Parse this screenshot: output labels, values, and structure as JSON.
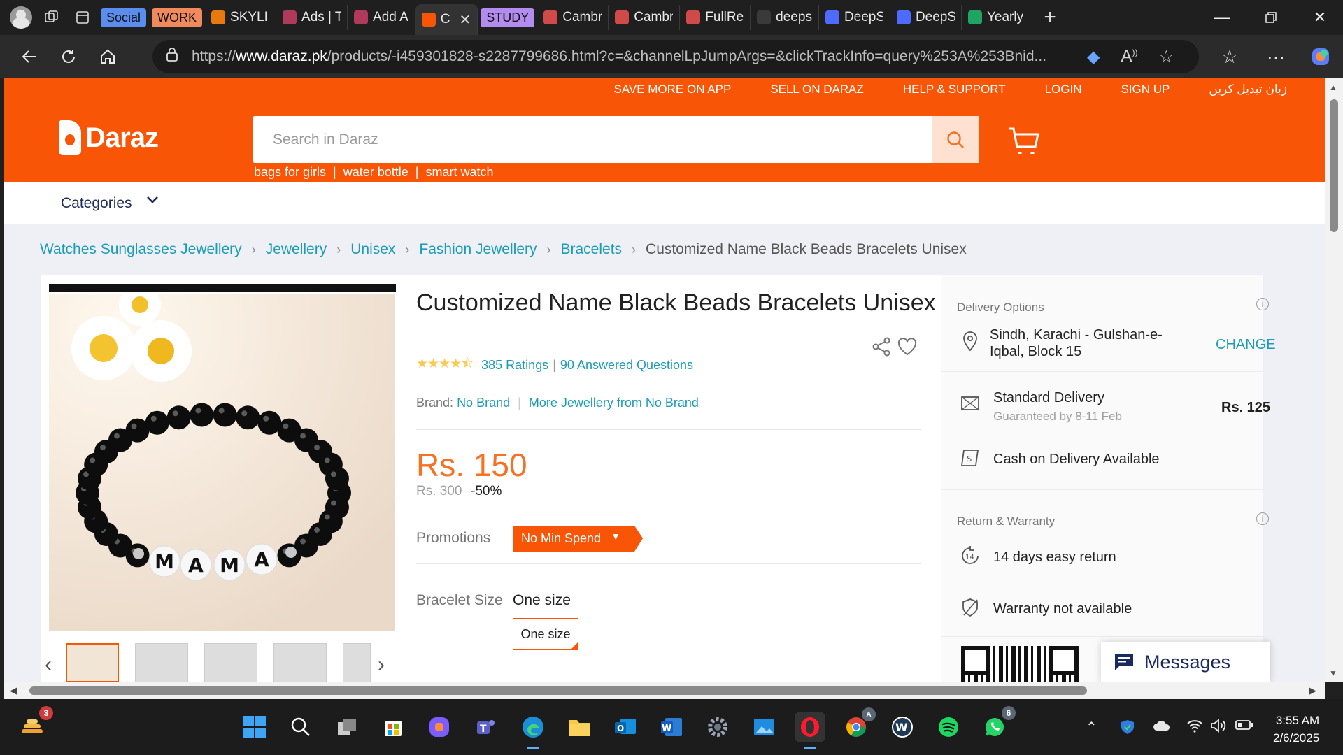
{
  "browser": {
    "tabs": [
      {
        "label": "Social",
        "type": "group",
        "color": "#5b8def"
      },
      {
        "label": "WORK",
        "type": "group",
        "color": "#f08a5d"
      },
      {
        "label": "SKYLIN",
        "icon": "skyline-favicon",
        "color": "#e8790f"
      },
      {
        "label": "Ads | T",
        "icon": "ads-favicon",
        "color": "#b03a5b"
      },
      {
        "label": "Add A",
        "icon": "add-favicon",
        "color": "#b03a5b"
      },
      {
        "label": "C",
        "icon": "daraz-favicon",
        "color": "#f85606",
        "active": true
      },
      {
        "label": "STUDY",
        "type": "group",
        "color": "#b48cf0"
      },
      {
        "label": "Cambr",
        "icon": "pdf-favicon",
        "color": "#d04a4a"
      },
      {
        "label": "Cambr",
        "icon": "pdf-favicon",
        "color": "#d04a4a"
      },
      {
        "label": "FullRe",
        "icon": "pdf-favicon",
        "color": "#d04a4a"
      },
      {
        "label": "deeps",
        "icon": "search-favicon",
        "color": "#3a3a3a"
      },
      {
        "label": "DeepS",
        "icon": "deepseek-favicon",
        "color": "#4d6bfe"
      },
      {
        "label": "DeepS",
        "icon": "deepseek-favicon",
        "color": "#4d6bfe"
      },
      {
        "label": "Yearly",
        "icon": "drive-favicon",
        "color": "#1fa463"
      }
    ],
    "url_scheme": "https://",
    "url_host": "www.daraz.pk",
    "url_path": "/products/-i459301828-s2287799686.html?c=&channelLpJumpArgs=&clickTrackInfo=query%253A%253Bnid..."
  },
  "header": {
    "top_links": [
      "SAVE MORE ON APP",
      "SELL ON DARAZ",
      "HELP & SUPPORT",
      "LOGIN",
      "SIGN UP",
      "زبان تبدیل کریں"
    ],
    "logo_text": "Daraz",
    "search_placeholder": "Search in Daraz",
    "suggestions": [
      "bags for girls",
      "water bottle",
      "smart watch"
    ],
    "categories_label": "Categories"
  },
  "breadcrumbs": [
    "Watches Sunglasses Jewellery",
    "Jewellery",
    "Unisex",
    "Fashion Jewellery",
    "Bracelets",
    "Customized Name Black Beads Bracelets Unisex"
  ],
  "product": {
    "title": "Customized Name Black Beads Bracelets Unisex",
    "rating": 4.5,
    "rating_stars": "★★★★⯪",
    "ratings_count": "385 Ratings",
    "answered": "90 Answered Questions",
    "brand_label": "Brand:",
    "brand": "No Brand",
    "more_from": "More Jewellery from No Brand",
    "price": "Rs. 150",
    "original_price": "Rs. 300",
    "discount": "-50%",
    "promotions_label": "Promotions",
    "promotion_tag": "No Min Spend",
    "size_label": "Bracelet Size",
    "size_value": "One size",
    "size_option": "One size",
    "image_letters": [
      "M",
      "A",
      "M",
      "A"
    ]
  },
  "side": {
    "delivery_heading": "Delivery Options",
    "location_line1": "Sindh, Karachi - Gulshan-e-",
    "location_line2": "Iqbal, Block 15",
    "change_label": "CHANGE",
    "standard_delivery": "Standard Delivery",
    "guarantee": "Guaranteed by 8-11 Feb",
    "delivery_fee": "Rs. 125",
    "cod": "Cash on Delivery Available",
    "return_heading": "Return & Warranty",
    "return_policy": "14 days easy return",
    "warranty": "Warranty not available",
    "return_days_icon": "14"
  },
  "messages_label": "Messages",
  "taskbar": {
    "widgets_badge": "3",
    "whatsapp_badge": "6",
    "time": "3:55 AM",
    "date": "2/6/2025"
  }
}
